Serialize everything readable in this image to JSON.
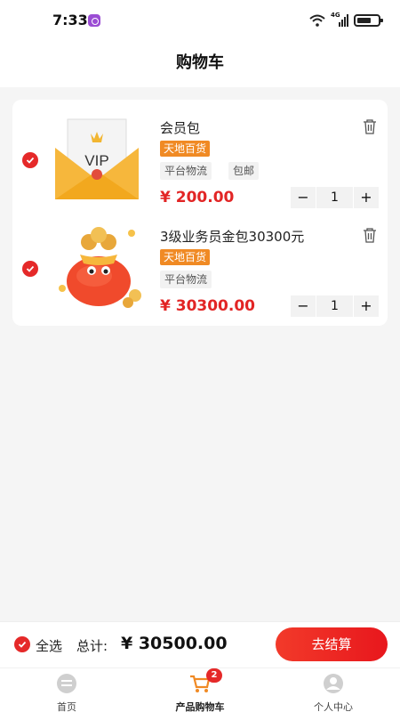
{
  "status_bar": {
    "time": "7:33",
    "network": "4G"
  },
  "header": {
    "title": "购物车"
  },
  "cart": {
    "items": [
      {
        "name": "会员包",
        "store_tag": "天地百货",
        "tags": [
          "平台物流",
          "包邮"
        ],
        "price": "¥ 200.00",
        "quantity": "1",
        "selected": true
      },
      {
        "name": "3级业务员金包30300元",
        "store_tag": "天地百货",
        "tags": [
          "平台物流"
        ],
        "price": "¥ 30300.00",
        "quantity": "1",
        "selected": true
      }
    ]
  },
  "checkout": {
    "select_all_label": "全选",
    "total_label": "总计:",
    "total_value": "¥ 30500.00",
    "button_label": "去结算"
  },
  "tabbar": {
    "tabs": [
      {
        "label": "首页"
      },
      {
        "label": "产品购物车",
        "badge": "2",
        "active": true
      },
      {
        "label": "个人中心"
      }
    ]
  },
  "colors": {
    "accent": "#e52929",
    "store_tag": "#f08a24",
    "price": "#e22525"
  },
  "icons": [
    "wifi-icon",
    "signal-icon",
    "battery-icon",
    "check-icon",
    "trash-icon",
    "home-icon",
    "cart-icon",
    "profile-icon"
  ]
}
